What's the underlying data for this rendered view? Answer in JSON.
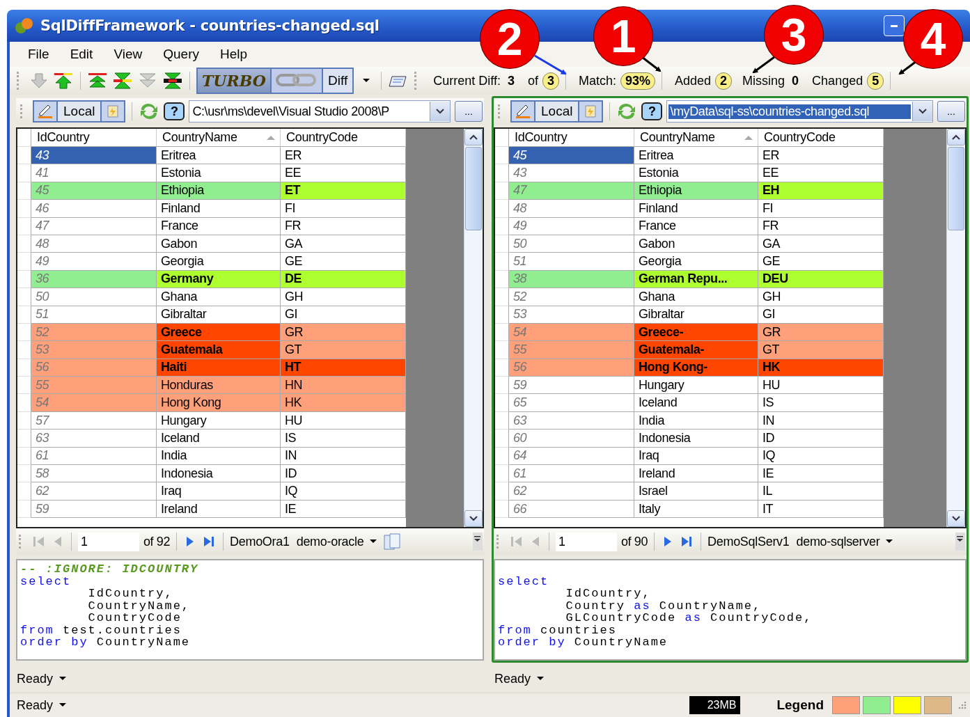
{
  "window": {
    "title": "SqlDiffFramework - countries-changed.sql"
  },
  "menu": [
    "File",
    "Edit",
    "View",
    "Query",
    "Help"
  ],
  "toolbar": {
    "turbo_label": "TURBO",
    "diff_label": "Diff",
    "stats": [
      {
        "label": "Current Diff:",
        "value": "3",
        "highlighted": false
      },
      {
        "label": "of",
        "value": "3",
        "highlighted": true
      },
      {
        "label": "Match:",
        "value": "93%",
        "highlighted": true
      },
      {
        "label": "Added",
        "value": "2",
        "highlighted": true
      },
      {
        "label": "Missing",
        "value": "0",
        "highlighted": false
      },
      {
        "label": "Changed",
        "value": "5",
        "highlighted": true
      }
    ]
  },
  "callouts": [
    {
      "number": "2",
      "color": "#1a3ae8"
    },
    {
      "number": "1",
      "color": "#000000"
    },
    {
      "number": "3",
      "color": "#000000"
    },
    {
      "number": "4",
      "color": "#000000"
    }
  ],
  "panes": [
    {
      "active": false,
      "source_label": "Local",
      "help_label": "?",
      "path": "C:\\usr\\ms\\devel\\Visual Studio 2008\\P",
      "path_selected": false,
      "browse_label": "...",
      "columns": [
        {
          "label": "IdCountry",
          "sorted": false
        },
        {
          "label": "CountryName",
          "sorted": true
        },
        {
          "label": "CountryCode",
          "sorted": false
        }
      ],
      "rows": [
        {
          "id": "43",
          "name": "Eritrea",
          "code": "ER",
          "kind": "same",
          "name_diff": false,
          "code_diff": false,
          "selected": true
        },
        {
          "id": "41",
          "name": "Estonia",
          "code": "EE",
          "kind": "same",
          "name_diff": false,
          "code_diff": false,
          "selected": false
        },
        {
          "id": "45",
          "name": "Ethiopia",
          "code": "ET",
          "kind": "changed",
          "name_diff": false,
          "code_diff": true,
          "selected": false
        },
        {
          "id": "46",
          "name": "Finland",
          "code": "FI",
          "kind": "same",
          "name_diff": false,
          "code_diff": false,
          "selected": false
        },
        {
          "id": "47",
          "name": "France",
          "code": "FR",
          "kind": "same",
          "name_diff": false,
          "code_diff": false,
          "selected": false
        },
        {
          "id": "48",
          "name": "Gabon",
          "code": "GA",
          "kind": "same",
          "name_diff": false,
          "code_diff": false,
          "selected": false
        },
        {
          "id": "49",
          "name": "Georgia",
          "code": "GE",
          "kind": "same",
          "name_diff": false,
          "code_diff": false,
          "selected": false
        },
        {
          "id": "36",
          "name": "Germany",
          "code": "DE",
          "kind": "changed",
          "name_diff": true,
          "code_diff": true,
          "selected": false
        },
        {
          "id": "50",
          "name": "Ghana",
          "code": "GH",
          "kind": "same",
          "name_diff": false,
          "code_diff": false,
          "selected": false
        },
        {
          "id": "51",
          "name": "Gibraltar",
          "code": "GI",
          "kind": "same",
          "name_diff": false,
          "code_diff": false,
          "selected": false
        },
        {
          "id": "52",
          "name": "Greece",
          "code": "GR",
          "kind": "unmatched",
          "name_diff": true,
          "code_diff": false,
          "selected": false
        },
        {
          "id": "53",
          "name": "Guatemala",
          "code": "GT",
          "kind": "unmatched",
          "name_diff": true,
          "code_diff": false,
          "selected": false
        },
        {
          "id": "56",
          "name": "Haiti",
          "code": "HT",
          "kind": "unmatched",
          "name_diff": true,
          "code_diff": true,
          "selected": false
        },
        {
          "id": "55",
          "name": "Honduras",
          "code": "HN",
          "kind": "unmatched",
          "name_diff": false,
          "code_diff": false,
          "selected": false
        },
        {
          "id": "54",
          "name": "Hong Kong",
          "code": "HK",
          "kind": "unmatched",
          "name_diff": false,
          "code_diff": false,
          "selected": false
        },
        {
          "id": "57",
          "name": "Hungary",
          "code": "HU",
          "kind": "same",
          "name_diff": false,
          "code_diff": false,
          "selected": false
        },
        {
          "id": "63",
          "name": "Iceland",
          "code": "IS",
          "kind": "same",
          "name_diff": false,
          "code_diff": false,
          "selected": false
        },
        {
          "id": "61",
          "name": "India",
          "code": "IN",
          "kind": "same",
          "name_diff": false,
          "code_diff": false,
          "selected": false
        },
        {
          "id": "58",
          "name": "Indonesia",
          "code": "ID",
          "kind": "same",
          "name_diff": false,
          "code_diff": false,
          "selected": false
        },
        {
          "id": "62",
          "name": "Iraq",
          "code": "IQ",
          "kind": "same",
          "name_diff": false,
          "code_diff": false,
          "selected": false
        },
        {
          "id": "59",
          "name": "Ireland",
          "code": "IE",
          "kind": "same",
          "name_diff": false,
          "code_diff": false,
          "selected": false
        }
      ],
      "page": "1",
      "page_count": "of 92",
      "connection": "DemoOra1",
      "database": "demo-oracle",
      "show_doc_icon": true,
      "sql": [
        [
          {
            "text": "-- :IGNORE: IDCOUNTRY",
            "kind": "comment"
          }
        ],
        [
          {
            "text": "select",
            "kind": "keyword"
          }
        ],
        [
          {
            "text": "        IdCountry,",
            "kind": "plain"
          }
        ],
        [
          {
            "text": "        CountryName,",
            "kind": "plain"
          }
        ],
        [
          {
            "text": "        CountryCode",
            "kind": "plain"
          }
        ],
        [
          {
            "text": "from",
            "kind": "keyword"
          },
          {
            "text": " test.countries",
            "kind": "plain"
          }
        ],
        [
          {
            "text": "order by",
            "kind": "keyword"
          },
          {
            "text": " CountryName",
            "kind": "plain"
          }
        ]
      ],
      "status": "Ready"
    },
    {
      "active": true,
      "source_label": "Local",
      "help_label": "?",
      "path": "\\myData\\sql-ss\\countries-changed.sql",
      "path_selected": true,
      "browse_label": "...",
      "columns": [
        {
          "label": "IdCountry",
          "sorted": false
        },
        {
          "label": "CountryName",
          "sorted": true
        },
        {
          "label": "CountryCode",
          "sorted": false
        }
      ],
      "rows": [
        {
          "id": "45",
          "name": "Eritrea",
          "code": "ER",
          "kind": "same",
          "name_diff": false,
          "code_diff": false,
          "selected": true
        },
        {
          "id": "43",
          "name": "Estonia",
          "code": "EE",
          "kind": "same",
          "name_diff": false,
          "code_diff": false,
          "selected": false
        },
        {
          "id": "47",
          "name": "Ethiopia",
          "code": "EH",
          "kind": "changed",
          "name_diff": false,
          "code_diff": true,
          "selected": false
        },
        {
          "id": "48",
          "name": "Finland",
          "code": "FI",
          "kind": "same",
          "name_diff": false,
          "code_diff": false,
          "selected": false
        },
        {
          "id": "49",
          "name": "France",
          "code": "FR",
          "kind": "same",
          "name_diff": false,
          "code_diff": false,
          "selected": false
        },
        {
          "id": "50",
          "name": "Gabon",
          "code": "GA",
          "kind": "same",
          "name_diff": false,
          "code_diff": false,
          "selected": false
        },
        {
          "id": "51",
          "name": "Georgia",
          "code": "GE",
          "kind": "same",
          "name_diff": false,
          "code_diff": false,
          "selected": false
        },
        {
          "id": "38",
          "name": "German Repu...",
          "code": "DEU",
          "kind": "changed",
          "name_diff": true,
          "code_diff": true,
          "selected": false
        },
        {
          "id": "52",
          "name": "Ghana",
          "code": "GH",
          "kind": "same",
          "name_diff": false,
          "code_diff": false,
          "selected": false
        },
        {
          "id": "53",
          "name": "Gibraltar",
          "code": "GI",
          "kind": "same",
          "name_diff": false,
          "code_diff": false,
          "selected": false
        },
        {
          "id": "54",
          "name": "Greece-",
          "code": "GR",
          "kind": "unmatched",
          "name_diff": true,
          "code_diff": false,
          "selected": false
        },
        {
          "id": "55",
          "name": "Guatemala-",
          "code": "GT",
          "kind": "unmatched",
          "name_diff": true,
          "code_diff": false,
          "selected": false
        },
        {
          "id": "56",
          "name": "Hong Kong-",
          "code": "HK",
          "kind": "unmatched",
          "name_diff": true,
          "code_diff": true,
          "selected": false
        },
        {
          "id": "59",
          "name": "Hungary",
          "code": "HU",
          "kind": "same",
          "name_diff": false,
          "code_diff": false,
          "selected": false
        },
        {
          "id": "65",
          "name": "Iceland",
          "code": "IS",
          "kind": "same",
          "name_diff": false,
          "code_diff": false,
          "selected": false
        },
        {
          "id": "63",
          "name": "India",
          "code": "IN",
          "kind": "same",
          "name_diff": false,
          "code_diff": false,
          "selected": false
        },
        {
          "id": "60",
          "name": "Indonesia",
          "code": "ID",
          "kind": "same",
          "name_diff": false,
          "code_diff": false,
          "selected": false
        },
        {
          "id": "64",
          "name": "Iraq",
          "code": "IQ",
          "kind": "same",
          "name_diff": false,
          "code_diff": false,
          "selected": false
        },
        {
          "id": "61",
          "name": "Ireland",
          "code": "IE",
          "kind": "same",
          "name_diff": false,
          "code_diff": false,
          "selected": false
        },
        {
          "id": "62",
          "name": "Israel",
          "code": "IL",
          "kind": "same",
          "name_diff": false,
          "code_diff": false,
          "selected": false
        },
        {
          "id": "66",
          "name": "Italy",
          "code": "IT",
          "kind": "same",
          "name_diff": false,
          "code_diff": false,
          "selected": false
        }
      ],
      "page": "1",
      "page_count": "of 90",
      "connection": "DemoSqlServ1",
      "database": "demo-sqlserver",
      "blank_first_line": true,
      "sql": [
        [
          {
            "text": "select",
            "kind": "keyword"
          }
        ],
        [
          {
            "text": "        IdCountry,",
            "kind": "plain"
          }
        ],
        [
          {
            "text": "        Country ",
            "kind": "plain"
          },
          {
            "text": "as",
            "kind": "keyword"
          },
          {
            "text": " CountryName,",
            "kind": "plain"
          }
        ],
        [
          {
            "text": "        GLCountryCode ",
            "kind": "plain"
          },
          {
            "text": "as",
            "kind": "keyword"
          },
          {
            "text": " CountryCode,",
            "kind": "plain"
          }
        ],
        [
          {
            "text": "from",
            "kind": "keyword"
          },
          {
            "text": " countries",
            "kind": "plain"
          }
        ],
        [
          {
            "text": "order by",
            "kind": "keyword"
          },
          {
            "text": " CountryName",
            "kind": "plain"
          }
        ]
      ],
      "status": "Ready"
    }
  ],
  "status_bar": {
    "status": "Ready",
    "memory": "23MB",
    "legend_label": "Legend",
    "legend": [
      {
        "color": "#ffa07a"
      },
      {
        "color": "#90ee90"
      },
      {
        "color": "#ffff00"
      },
      {
        "color": "#deb887"
      }
    ]
  }
}
